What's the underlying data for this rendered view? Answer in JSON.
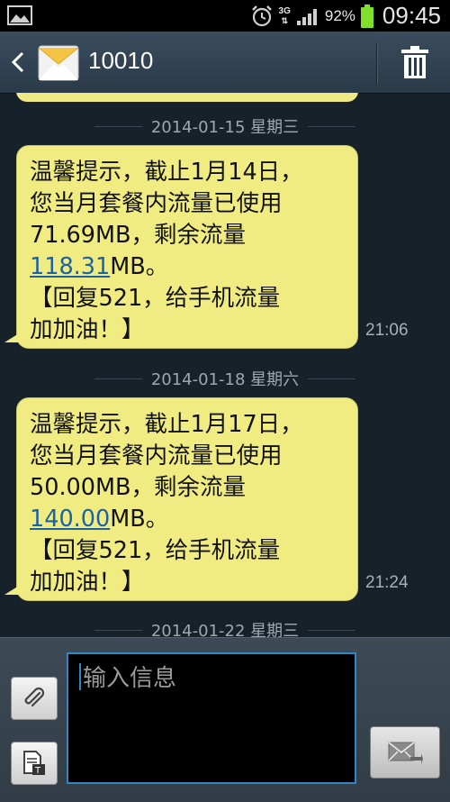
{
  "status_bar": {
    "network": "3G",
    "battery_percent": "92%",
    "time": "09:45"
  },
  "header": {
    "title": "10010"
  },
  "messages": [
    {
      "date": "2014-01-15 星期三",
      "line1": "温馨提示，截止1月14日，",
      "line2": "您当月套餐内流量已使用",
      "line3": "71.69MB，剩余流量",
      "link": "118.31",
      "after_link": "MB。",
      "line5": "【回复521，给手机流量",
      "line6": "加加油！】",
      "time": "21:06"
    },
    {
      "date": "2014-01-18 星期六",
      "line1": "温馨提示，截止1月17日，",
      "line2": "您当月套餐内流量已使用",
      "line3": "50.00MB，剩余流量",
      "link": "140.00",
      "after_link": "MB。",
      "line5": "【回复521，给手机流量",
      "line6": "加加油！】",
      "time": "21:24"
    }
  ],
  "next_date": "2014-01-22 星期三",
  "composer": {
    "placeholder": "输入信息"
  },
  "icons": {
    "gallery": "gallery-icon",
    "alarm": "alarm-icon",
    "signal": "signal-icon",
    "battery": "battery-icon",
    "back": "back-arrow-icon",
    "envelope": "envelope-icon",
    "trash": "trash-icon",
    "attach": "paperclip-icon",
    "template": "template-icon",
    "send": "send-icon"
  },
  "colors": {
    "bubble": "#f0ec82",
    "link": "#1a62a8",
    "input_border": "#2f86c8",
    "battery": "#7ee02a"
  }
}
